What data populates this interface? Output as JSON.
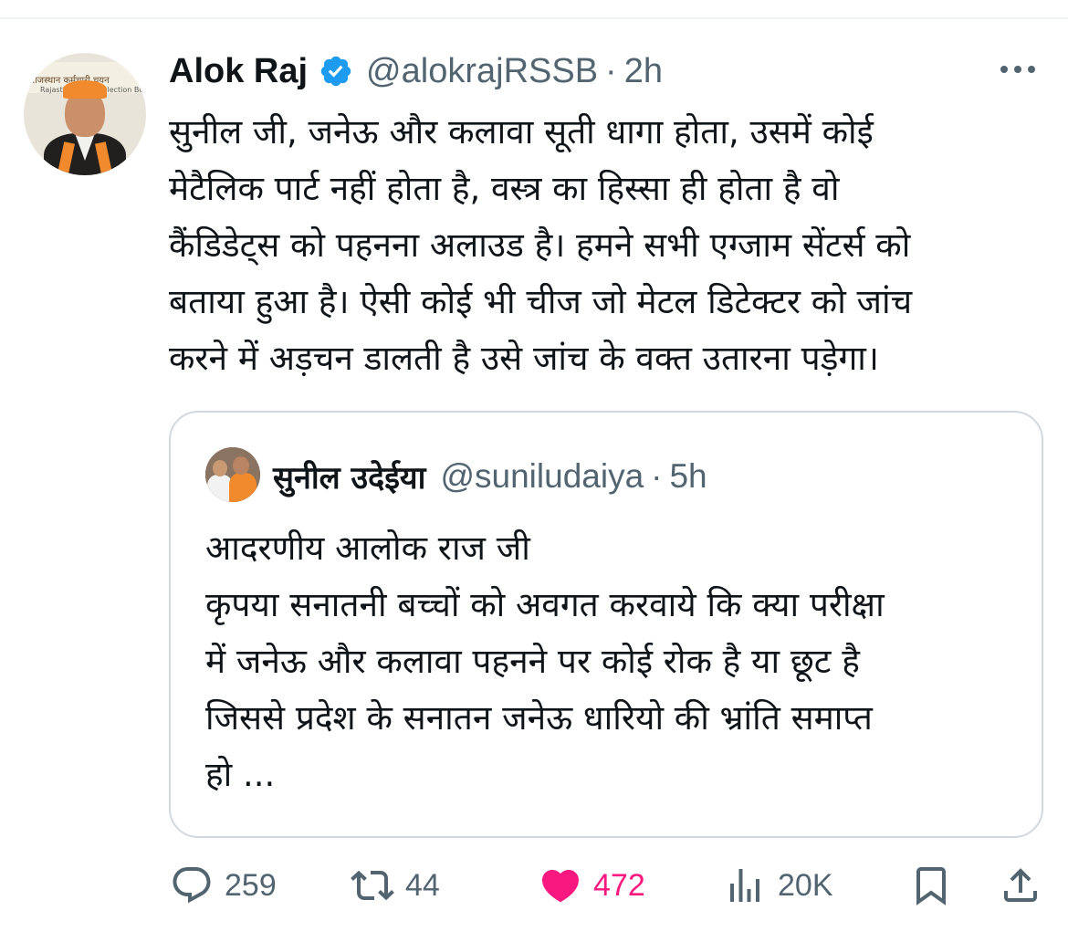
{
  "tweet": {
    "author": {
      "name": "Alok Raj",
      "handle": "@alokrajRSSB",
      "verified": true,
      "avatar_banner_text": "राजस्थान कर्मचारी चयन",
      "avatar_banner_text2": "Rajasthan Staff Selection Board"
    },
    "separator": "·",
    "time": "2h",
    "text": "सुनील जी, जनेऊ और कलावा सूती धागा होता, उसमें कोई\nमेटैलिक पार्ट नहीं होता है, वस्त्र का हिस्सा ही होता है वो\nकैंडिडेट्स को पहनना अलाउड है। हमने सभी एग्जाम सेंटर्स को\nबताया हुआ है। ऐसी कोई भी चीज जो मेटल डिटेक्टर को जांच\nकरने में अड़चन डालती है उसे जांच के वक्त उतारना पड़ेगा।",
    "quoted": {
      "name": "सुनील उदेईया",
      "handle": "@suniludaiya",
      "separator": "·",
      "time": "5h",
      "text": "आदरणीय आलोक राज जी\nकृपया सनातनी बच्चों को अवगत करवाये कि क्या परीक्षा\nमें जनेऊ और कलावा पहनने पर कोई रोक है या छूट है\nजिससे प्रदेश के सनातन जनेऊ धारियो की भ्रांति समाप्त\nहो ..."
    },
    "actions": {
      "replies": "259",
      "reposts": "44",
      "likes": "472",
      "views": "20K"
    }
  },
  "colors": {
    "text": "#0f1419",
    "secondary": "#536471",
    "verified_blue": "#1d9bf0",
    "like_pink": "#f91880",
    "border": "#cfd9de"
  },
  "icons": [
    "more-icon",
    "verified-badge-icon",
    "reply-icon",
    "repost-icon",
    "like-icon",
    "views-icon",
    "bookmark-icon",
    "share-icon"
  ]
}
